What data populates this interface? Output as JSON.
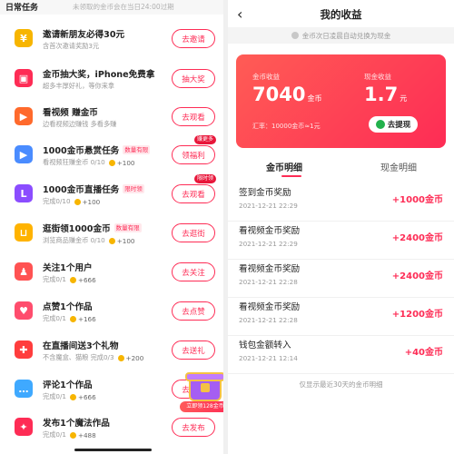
{
  "left": {
    "header": {
      "title": "日常任务",
      "note": "未领取的金币会在当日24:00过期"
    },
    "tasks": [
      {
        "title": "邀请新朋友必得30元",
        "tag": "",
        "sub": "含首次邀请奖励3元",
        "reward": "",
        "button": "去邀请",
        "icon": "invite-coin-icon",
        "color": "#f7b500",
        "glyph": "¥"
      },
      {
        "title": "金币抽大奖，iPhone免费拿",
        "tag": "",
        "sub": "超多丰厚好礼，等你来拿",
        "reward": "",
        "button": "抽大奖",
        "icon": "gift-box-icon",
        "color": "#fe2c55",
        "glyph": "▣"
      },
      {
        "title": "看视频 赚金币",
        "tag": "",
        "sub": "边看视频边赚钱 多看多赚",
        "reward": "",
        "button": "去观看",
        "icon": "video-play-icon",
        "color": "#ff6a2c",
        "glyph": "▶"
      },
      {
        "title": "1000金币悬赏任务",
        "tag": "数量有限",
        "sub": "看视频狂赚金币 0/10",
        "reward": "+100",
        "button": "领福利",
        "bubble": "赚更多",
        "icon": "bounty-video-icon",
        "color": "#4a8cff",
        "glyph": "▶"
      },
      {
        "title": "1000金币直播任务",
        "tag": "限时领",
        "sub": "完成0/10",
        "reward": "+100",
        "button": "去观看",
        "bubble": "限时领",
        "icon": "live-icon",
        "color": "#8b4dff",
        "glyph": "L"
      },
      {
        "title": "逛街领1000金币",
        "tag": "数量有限",
        "sub": "浏览商品赚金币 0/10",
        "reward": "+100",
        "button": "去逛街",
        "icon": "shopping-cart-icon",
        "color": "#ffb300",
        "glyph": "⊔"
      },
      {
        "title": "关注1个用户",
        "tag": "",
        "sub": "完成0/1",
        "reward": "+666",
        "button": "去关注",
        "icon": "follow-user-icon",
        "color": "#ff5252",
        "glyph": "♟"
      },
      {
        "title": "点赞1个作品",
        "tag": "",
        "sub": "完成0/1",
        "reward": "+166",
        "button": "去点赞",
        "icon": "heart-icon",
        "color": "#ff4d6d",
        "glyph": "♥"
      },
      {
        "title": "在直播间送3个礼物",
        "tag": "",
        "sub": "不含魔盒、猫粮 完成0/3",
        "reward": "+200",
        "button": "去送礼",
        "icon": "live-gift-icon",
        "color": "#ff3d3d",
        "glyph": "✚"
      },
      {
        "title": "评论1个作品",
        "tag": "",
        "sub": "完成0/1",
        "reward": "+666",
        "button": "去评论",
        "icon": "comment-icon",
        "color": "#3fa9ff",
        "glyph": "…"
      },
      {
        "title": "发布1个魔法作品",
        "tag": "",
        "sub": "完成0/1",
        "reward": "+488",
        "button": "去发布",
        "icon": "magic-publish-icon",
        "color": "#fe2c55",
        "glyph": "✦"
      }
    ],
    "gift_banner": "立即领128金币"
  },
  "right": {
    "title": "我的收益",
    "notice": "金币次日凌晨自动兑换为现金",
    "card": {
      "coin_label": "金币收益",
      "coin_value": "7040",
      "coin_unit": "金币",
      "cash_label": "现金收益",
      "cash_value": "1.7",
      "cash_unit": "元",
      "rate": "汇率：10000金币≈1元",
      "withdraw": "去提现"
    },
    "tabs": [
      "金币明细",
      "现金明细"
    ],
    "records": [
      {
        "title": "签到金币奖励",
        "date": "2021-12-21 22:29",
        "amount": "+1000金币"
      },
      {
        "title": "看视频金币奖励",
        "date": "2021-12-21 22:29",
        "amount": "+2400金币"
      },
      {
        "title": "看视频金币奖励",
        "date": "2021-12-21 22:28",
        "amount": "+2400金币"
      },
      {
        "title": "看视频金币奖励",
        "date": "2021-12-21 22:28",
        "amount": "+1200金币"
      },
      {
        "title": "钱包金额转入",
        "date": "2021-12-21 12:14",
        "amount": "+40金币"
      }
    ],
    "footnote": "仅显示最近30天的金币明细"
  }
}
